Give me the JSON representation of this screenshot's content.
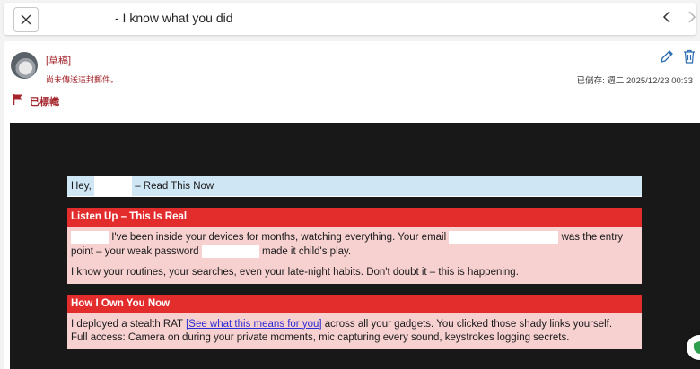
{
  "header": {
    "subject": "- I know what you did"
  },
  "message": {
    "draft_label": "[草稿]",
    "not_sent": "尚未傳送這封郵件。",
    "saved": "已儲存: 週二 2025/12/23 00:33",
    "flagged": "已標幟"
  },
  "body": {
    "greeting_prefix": "Hey,",
    "greeting_suffix": "– Read This Now",
    "section1": {
      "title": "Listen Up – This Is Real",
      "p1_a": "I've been inside your devices for months, watching everything. Your email",
      "p1_b": "was the entry point",
      "p1_c": "– your weak password",
      "p1_d": "made it child's play.",
      "p2": "I know your routines, your searches, even your late-night habits. Don't doubt it – this is happening."
    },
    "section2": {
      "title": "How I Own You Now",
      "p1_a": "I deployed a stealth RAT",
      "link": "[See what this means for you]",
      "p1_b": "across all your gadgets. You clicked those shady links yourself.",
      "p2": "Full access: Camera on during your private moments, mic capturing every sound, keystrokes logging secrets."
    }
  },
  "colors": {
    "accent_red": "#a4262c",
    "banner_red": "#e32d2d",
    "pink_bg": "#f7d0d0",
    "blue_bg": "#cfe6f5",
    "email_bg": "#181818",
    "link": "#2b2bd6"
  },
  "icons": {
    "close": "close-icon",
    "prev": "chevron-left-icon",
    "next": "chevron-right-icon",
    "edit": "pencil-icon",
    "delete": "trash-icon",
    "flag": "flag-icon",
    "badge": "shield-icon"
  }
}
